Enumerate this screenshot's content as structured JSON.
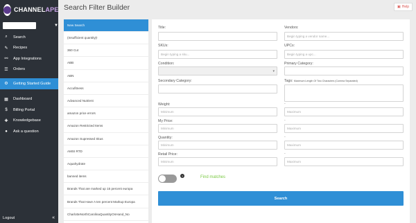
{
  "brand": {
    "name_main": "CHANNEL",
    "name_accent": "APE"
  },
  "sidebar": {
    "items": [
      {
        "label": "Search",
        "icon": "search-icon",
        "glyph": "⌕"
      },
      {
        "label": "Recipes",
        "icon": "wrench-icon",
        "glyph": "✎"
      },
      {
        "label": "App Integrations",
        "icon": "plug-icon",
        "glyph": "⚯"
      },
      {
        "label": "Orders",
        "icon": "list-icon",
        "glyph": "☰"
      },
      {
        "label": "Getting Started Guide",
        "icon": "gear-icon",
        "glyph": "⚙",
        "active": true
      },
      {
        "label": "Dashboard",
        "icon": "dashboard-icon",
        "glyph": "▦"
      },
      {
        "label": "Billing Portal",
        "icon": "money-icon",
        "glyph": "$"
      },
      {
        "label": "Knowledgebase",
        "icon": "book-icon",
        "glyph": "✚"
      },
      {
        "label": "Ask a question",
        "icon": "chat-icon",
        "glyph": "●"
      }
    ],
    "logout": "Logout",
    "collapse": "«"
  },
  "header": {
    "title": "Search Filter Builder",
    "help": "Help"
  },
  "saved_searches": [
    "New Search",
    "(Insufficient quantity)!",
    "360 Cut",
    "ABB",
    "ABN",
    "Accufitness",
    "Advanced Nutrient",
    "amazon price errors",
    "Amazon Restricted Items",
    "Amazon Supressed Skus",
    "AMSI RTD",
    "Aquahydrate",
    "banned items",
    "Brands That are marked up 15 percent europa",
    "Brands That Have A ten percent Markup Europa",
    "CharlotteNorthCarolinaQuantityOnHand_No"
  ],
  "form": {
    "title": {
      "label": "Title:",
      "value": ""
    },
    "vendors": {
      "label": "Vendors:",
      "placeholder": "Begin typing a vendor name..."
    },
    "skus": {
      "label": "SKUs:",
      "placeholder": "Begin typing a sku..."
    },
    "upcs": {
      "label": "UPCs:",
      "placeholder": "Begin typing a upc..."
    },
    "condition": {
      "label": "Condition:",
      "value": ""
    },
    "primary_category": {
      "label": "Primary Category:",
      "value": ""
    },
    "secondary_category": {
      "label": "Secondary Category:",
      "value": ""
    },
    "tags": {
      "label": "Tags:",
      "hint": "Maximum Length Of Two Characters (Comma Separated)",
      "value": ""
    },
    "weight": {
      "label": "Weight:",
      "min": "Minimum",
      "max": "Maximum"
    },
    "my_price": {
      "label": "My Price:",
      "min": "Minimum",
      "max": "Maximum"
    },
    "quantity": {
      "label": "Quantity:",
      "min": "Minimum",
      "max": "Maximum"
    },
    "retail_price": {
      "label": "Retail Price:",
      "min": "Minimum",
      "max": "Maximum"
    },
    "range_dash": "-",
    "info_glyph": "?",
    "find_matches": "Find matches",
    "search_button": "Search"
  }
}
